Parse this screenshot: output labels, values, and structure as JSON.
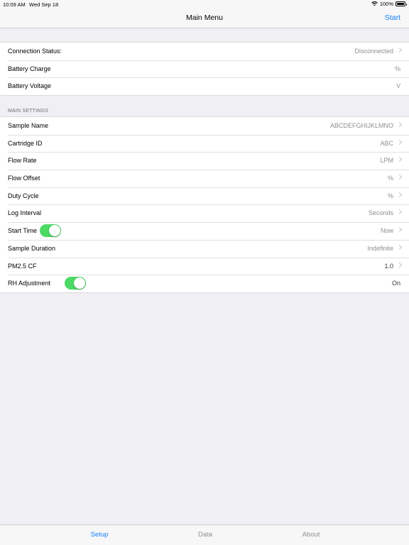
{
  "status_bar": {
    "time": "10:09 AM",
    "date": "Wed Sep 18",
    "battery": "100%"
  },
  "nav": {
    "title": "Main Menu",
    "action": "Start"
  },
  "status_rows": [
    {
      "label": "Connection Status:",
      "value": "Disconnected"
    },
    {
      "label": "Battery Charge",
      "value": "%"
    },
    {
      "label": "Battery Voltage",
      "value": "V"
    }
  ],
  "settings": {
    "header": "MAIN SETTINGS",
    "rows": [
      {
        "label": "Sample Name",
        "value": "ABCDEFGHIJKLMNO"
      },
      {
        "label": "Cartridge ID",
        "value": "ABC"
      },
      {
        "label": "Flow Rate",
        "value": "LPM"
      },
      {
        "label": "Flow Offset",
        "value": "%"
      },
      {
        "label": "Duty Cycle",
        "value": "%"
      },
      {
        "label": "Log Interval",
        "value": "Seconds"
      },
      {
        "label": "Start Time",
        "value": "Now",
        "toggle": true
      },
      {
        "label": "Sample Duration",
        "value": "Indefinite"
      },
      {
        "label": "PM2.5 CF",
        "value": "1.0"
      },
      {
        "label": "RH Adjustment",
        "value": "On",
        "toggle": true
      }
    ]
  },
  "tabs": [
    {
      "label": "Setup",
      "active": true
    },
    {
      "label": "Data",
      "active": false
    },
    {
      "label": "About",
      "active": false
    }
  ],
  "colors": {
    "accent": "#147efb",
    "toggle_on": "#4cd964",
    "background": "#efeff4"
  }
}
